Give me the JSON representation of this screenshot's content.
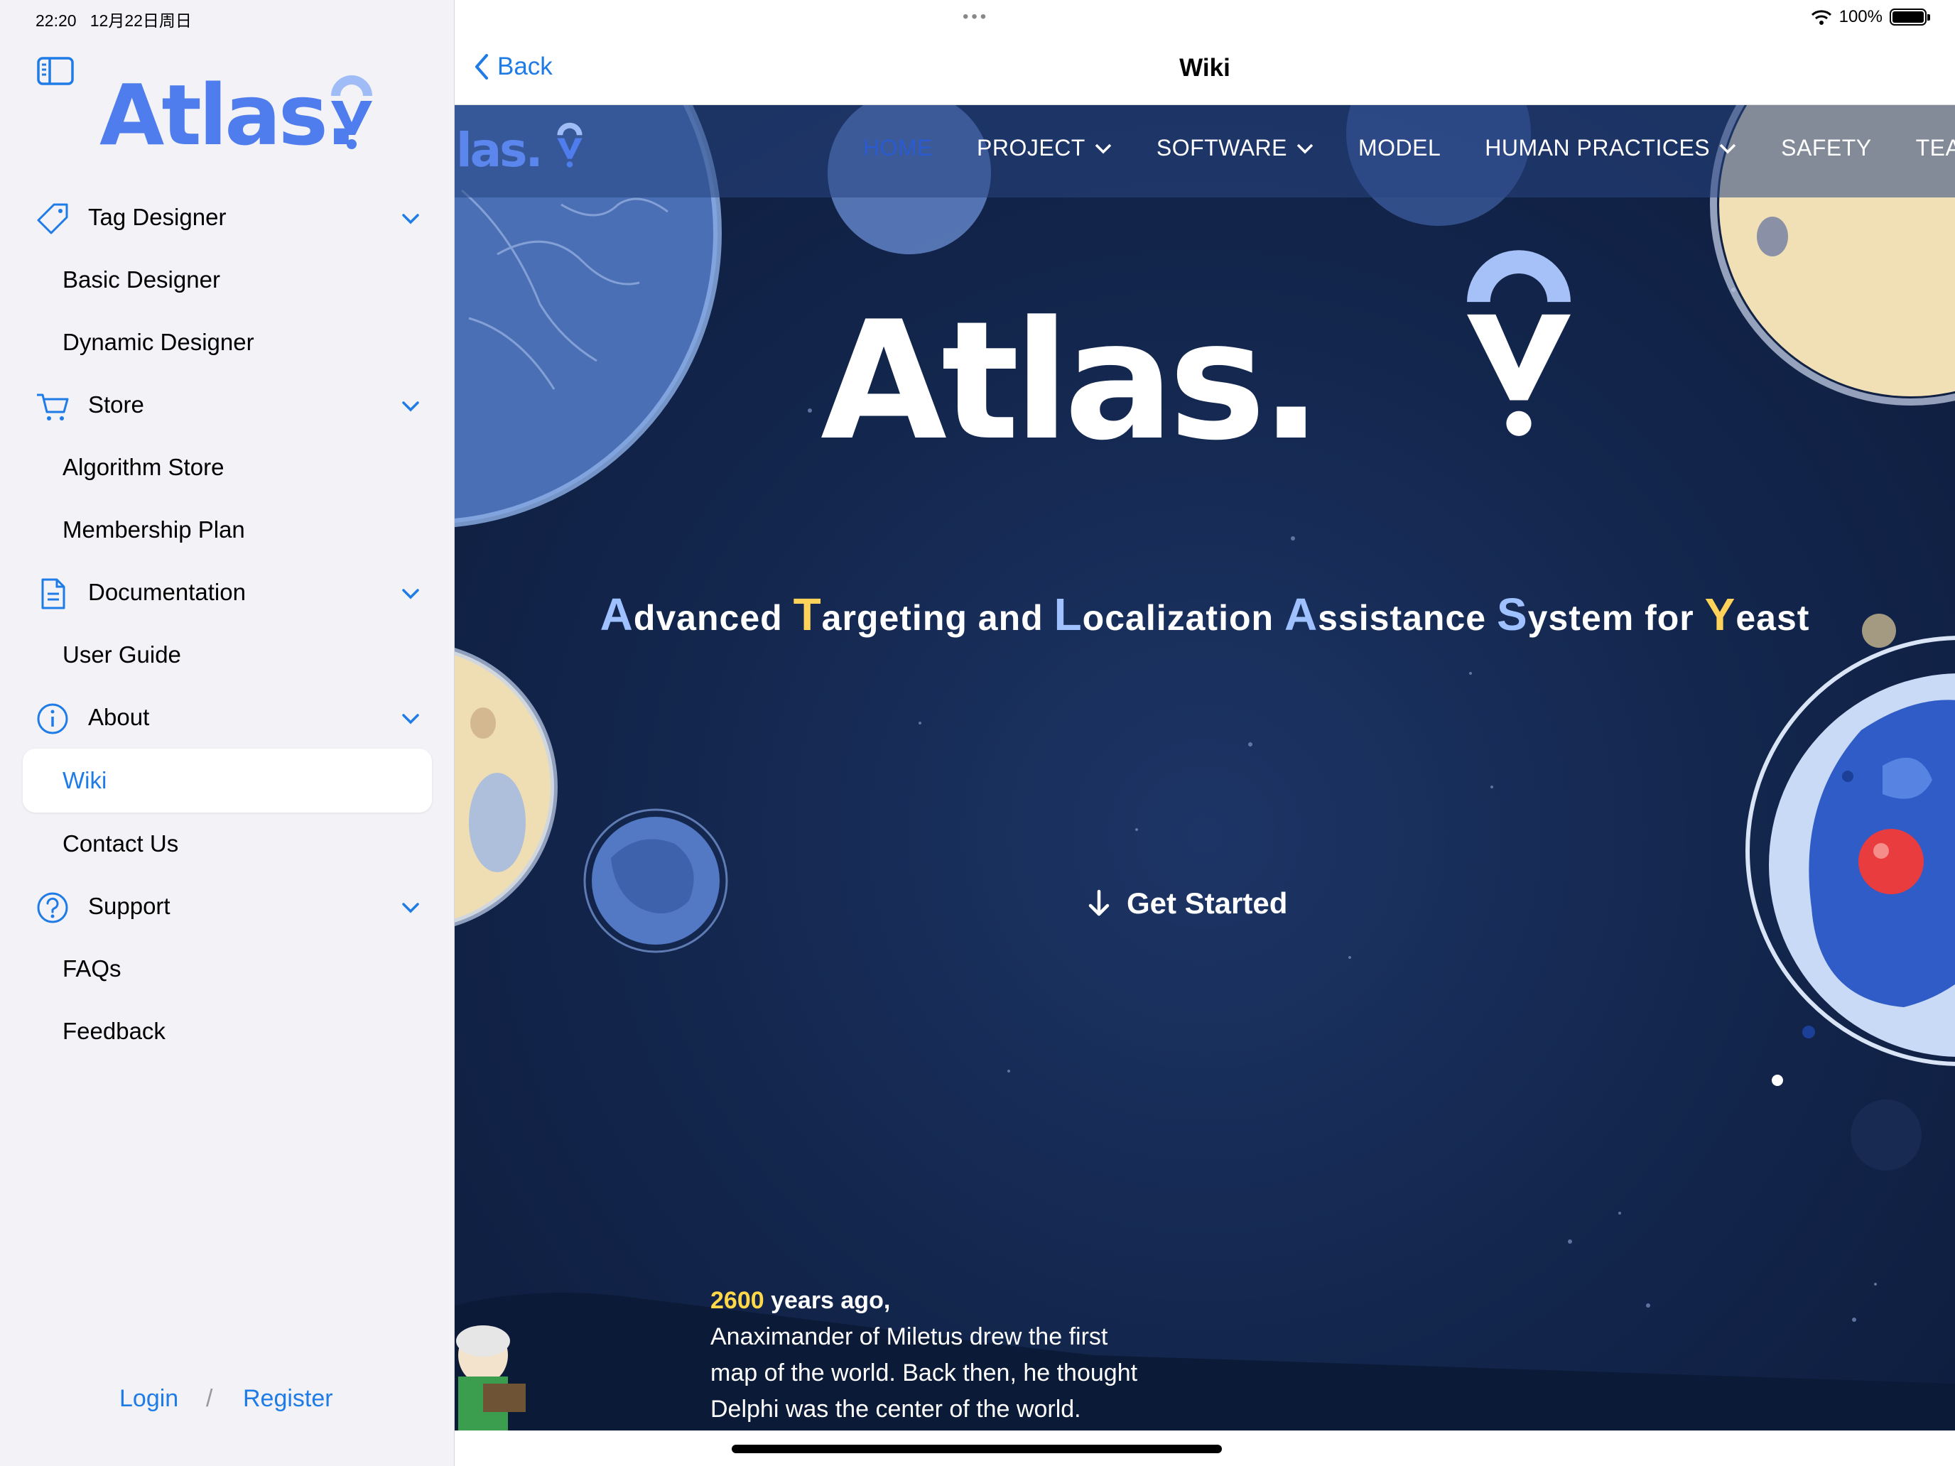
{
  "status_bar": {
    "time": "22:20",
    "date": "12月22日周日",
    "battery": "100%"
  },
  "sidebar": {
    "brand": "Atlas.",
    "groups": [
      {
        "label": "Tag Designer",
        "icon": "tag-icon",
        "items": [
          "Basic Designer",
          "Dynamic Designer"
        ]
      },
      {
        "label": "Store",
        "icon": "cart-icon",
        "items": [
          "Algorithm Store",
          "Membership Plan"
        ]
      },
      {
        "label": "Documentation",
        "icon": "document-icon",
        "items": [
          "User Guide"
        ]
      },
      {
        "label": "About",
        "icon": "info-icon",
        "items": [
          "Wiki",
          "Contact Us"
        ]
      },
      {
        "label": "Support",
        "icon": "question-icon",
        "items": [
          "FAQs",
          "Feedback"
        ]
      }
    ],
    "selected": "Wiki",
    "login": "Login",
    "slash": "/",
    "register": "Register"
  },
  "navbar": {
    "back": "Back",
    "title": "Wiki"
  },
  "site": {
    "logo": "las.",
    "nav": {
      "home": "HOME",
      "project": "PROJECT",
      "software": "SOFTWARE",
      "model": "MODEL",
      "human_practices": "HUMAN PRACTICES",
      "safety": "SAFETY",
      "team": "TEAM"
    },
    "hero_title": "Atlas.",
    "tagline": {
      "a": "A",
      "a_rest": "dvanced ",
      "t": "T",
      "t_rest": "argeting and ",
      "l": "L",
      "l_rest": "ocalization ",
      "a2": "A",
      "a2_rest": "ssistance ",
      "s": "S",
      "s_rest": "ystem for ",
      "y": "Y",
      "y_rest": "east"
    },
    "get_started": "Get Started",
    "story": {
      "year": "2600",
      "head": " years ago,",
      "line1": "Anaximander of Miletus drew the first",
      "line2": "map of the world. Back then, he thought",
      "line3": "Delphi was the center of the world."
    }
  },
  "colors": {
    "accent": "#1f7be6",
    "brand": "#4f7dee",
    "hero_bg": "#13264d",
    "highlight": "#ffd84a"
  }
}
